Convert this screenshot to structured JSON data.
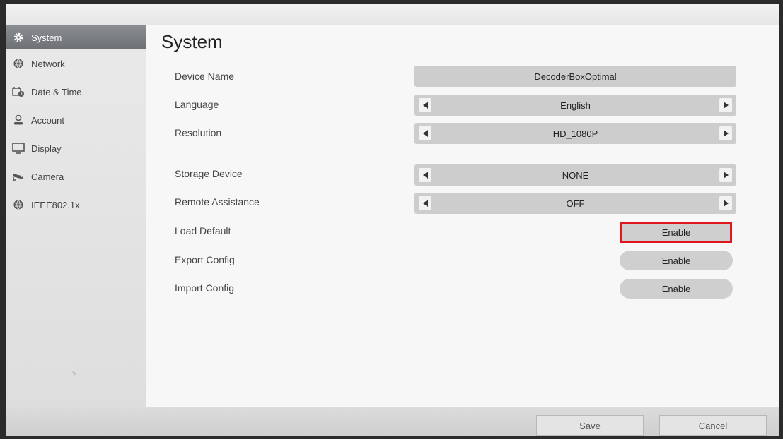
{
  "sidebar": {
    "items": [
      {
        "label": "System",
        "icon": "gear-icon",
        "active": true
      },
      {
        "label": "Network",
        "icon": "globe-icon",
        "active": false
      },
      {
        "label": "Date & Time",
        "icon": "calendar-clock-icon",
        "active": false
      },
      {
        "label": "Account",
        "icon": "user-icon",
        "active": false
      },
      {
        "label": "Display",
        "icon": "monitor-icon",
        "active": false
      },
      {
        "label": "Camera",
        "icon": "camera-icon",
        "active": false
      },
      {
        "label": "IEEE802.1x",
        "icon": "globe-icon",
        "active": false
      }
    ]
  },
  "main": {
    "title": "System",
    "device_name": {
      "label": "Device Name",
      "value": "DecoderBoxOptimal"
    },
    "language": {
      "label": "Language",
      "value": "English"
    },
    "resolution": {
      "label": "Resolution",
      "value": "HD_1080P"
    },
    "storage_device": {
      "label": "Storage Device",
      "value": "NONE"
    },
    "remote_assistance": {
      "label": "Remote Assistance",
      "value": "OFF"
    },
    "load_default": {
      "label": "Load Default",
      "button": "Enable"
    },
    "export_config": {
      "label": "Export Config",
      "button": "Enable"
    },
    "import_config": {
      "label": "Import Config",
      "button": "Enable"
    }
  },
  "footer": {
    "save": "Save",
    "cancel": "Cancel"
  },
  "colors": {
    "highlight": "#e0181e",
    "active_sidebar": "#7c7f83"
  }
}
